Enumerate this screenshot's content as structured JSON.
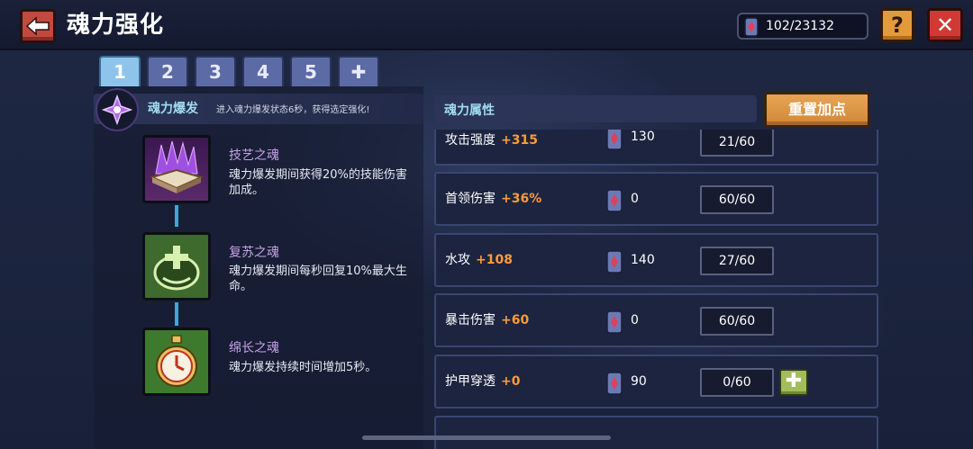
{
  "header": {
    "title": "魂力强化",
    "currency": "102/23132",
    "help_label": "?",
    "close_label": "✕"
  },
  "tabs": [
    {
      "label": "1",
      "active": true
    },
    {
      "label": "2",
      "active": false
    },
    {
      "label": "3",
      "active": false
    },
    {
      "label": "4",
      "active": false
    },
    {
      "label": "5",
      "active": false
    },
    {
      "label": "✚",
      "active": false
    }
  ],
  "burst": {
    "title": "魂力爆发",
    "description": "进入魂力爆发状态6秒，获得选定强化!"
  },
  "skills": [
    {
      "name": "技艺之魂",
      "description": "魂力爆发期间获得20%的技能伤害加成。",
      "icon": "purple-crystal-book-icon"
    },
    {
      "name": "复苏之魂",
      "description": "魂力爆发期间每秒回复10%最大生命。",
      "icon": "green-heal-plus-icon"
    },
    {
      "name": "绵长之魂",
      "description": "魂力爆发持续时间增加5秒。",
      "icon": "stopwatch-icon"
    }
  ],
  "attributes": {
    "header": "魂力属性",
    "reset_label": "重置加点",
    "rows": [
      {
        "name": "攻击强度",
        "bonus": "+315",
        "cost": "130",
        "level": "21/60",
        "can_add": false
      },
      {
        "name": "首领伤害",
        "bonus": "+36%",
        "cost": "0",
        "level": "60/60",
        "can_add": false
      },
      {
        "name": "水攻",
        "bonus": "+108",
        "cost": "140",
        "level": "27/60",
        "can_add": false
      },
      {
        "name": "暴击伤害",
        "bonus": "+60",
        "cost": "0",
        "level": "60/60",
        "can_add": false
      },
      {
        "name": "护甲穿透",
        "bonus": "+0",
        "cost": "90",
        "level": "0/60",
        "can_add": true
      }
    ],
    "add_label": "✚"
  },
  "colors": {
    "accent_cyan": "#9fdcf2",
    "bonus_orange": "#ff9a3a",
    "skill_name_purple": "#c8a0e8",
    "reset_orange": "#e49a3a",
    "close_red": "#cf3b34"
  }
}
